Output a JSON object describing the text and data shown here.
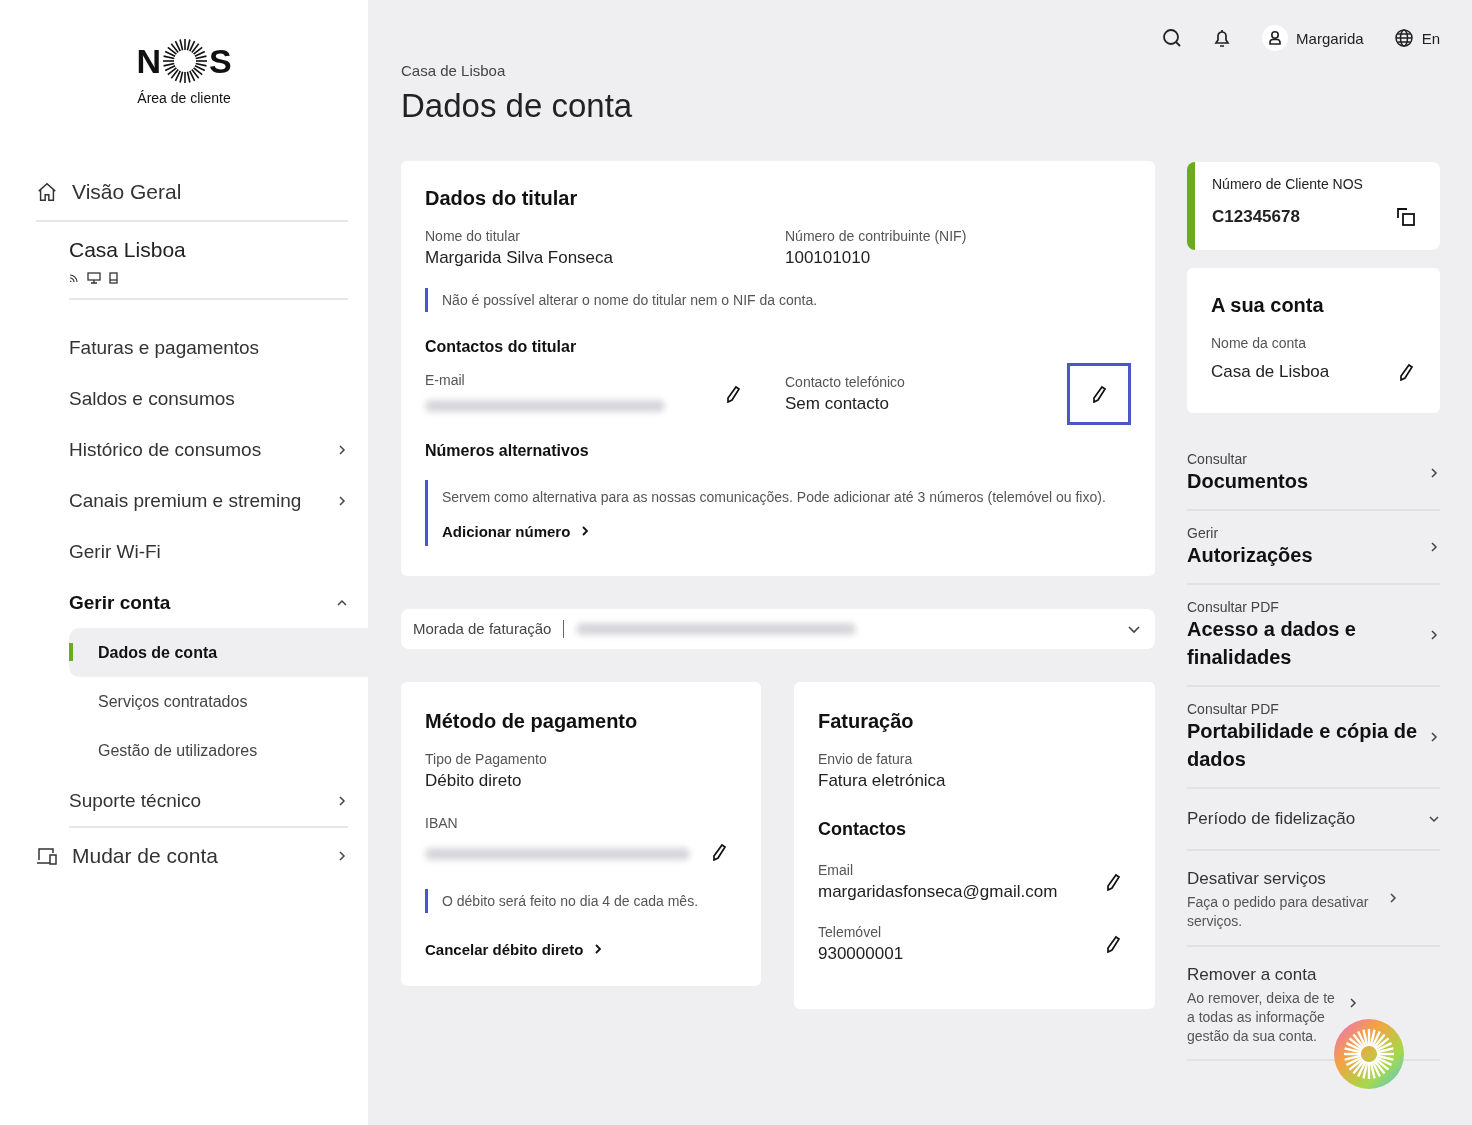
{
  "sidebar": {
    "logo": {
      "left": "N",
      "right": "S",
      "subtitle": "Área de cliente"
    },
    "overview": {
      "label": "Visão Geral"
    },
    "account": {
      "name": "Casa Lisboa"
    },
    "menu": [
      {
        "label": "Faturas e pagamentos",
        "has_submenu": false,
        "expanded": false
      },
      {
        "label": "Saldos e consumos",
        "has_submenu": false,
        "expanded": false
      },
      {
        "label": "Histórico de consumos",
        "has_submenu": true,
        "expanded": false
      },
      {
        "label": "Canais premium e streming",
        "has_submenu": true,
        "expanded": false
      },
      {
        "label": "Gerir Wi-Fi",
        "has_submenu": false,
        "expanded": false
      },
      {
        "label": "Gerir conta",
        "has_submenu": true,
        "expanded": true,
        "children": [
          {
            "label": "Dados de conta",
            "selected": true
          },
          {
            "label": "Serviços contratados",
            "selected": false
          },
          {
            "label": "Gestão de utilizadores",
            "selected": false
          }
        ]
      },
      {
        "label": "Suporte técnico",
        "has_submenu": true,
        "expanded": false
      }
    ],
    "switch_account": {
      "label": "Mudar de conta"
    }
  },
  "header": {
    "user": "Margarida",
    "language": "En"
  },
  "breadcrumb": "Casa de Lisboa",
  "title": "Dados de conta",
  "holder_card": {
    "title": "Dados do titular",
    "fields": [
      {
        "label": "Nome do titular",
        "value": "Margarida Silva Fonseca"
      },
      {
        "label": "Número de contribuinte (NIF)",
        "value": "100101010"
      }
    ],
    "note": "Não é possível alterar o nome do titular nem o NIF da conta.",
    "contacts_title": "Contactos do titular",
    "contacts": [
      {
        "label": "E-mail",
        "redacted": true,
        "highlighted": false
      },
      {
        "label": "Contacto telefónico",
        "value": "Sem contacto",
        "redacted": false,
        "highlighted": true
      }
    ],
    "alt_title": "Números alternativos",
    "alt_note": "Servem como alternativa para as nossas comunicações. Pode adicionar até 3 números (telemóvel ou fixo).",
    "alt_link": "Adicionar número"
  },
  "billing_address": {
    "label": "Morada de faturação",
    "expanded": false
  },
  "payment_card": {
    "title": "Método de pagamento",
    "type_label": "Tipo de Pagamento",
    "type_value": "Débito direto",
    "iban_label": "IBAN",
    "note": "O débito será feito no dia 4 de cada mês.",
    "link": "Cancelar débito direto"
  },
  "invoice_card": {
    "title": "Faturação",
    "send_label": "Envio de fatura",
    "send_value": "Fatura eletrónica",
    "contacts_title": "Contactos",
    "contacts": [
      {
        "label": "Email",
        "value": "margaridasfonseca@gmail.com"
      },
      {
        "label": "Telemóvel",
        "value": "930000001"
      }
    ]
  },
  "client_number": {
    "label": "Número de Cliente NOS",
    "value": "C12345678"
  },
  "your_account": {
    "title": "A sua conta",
    "label": "Nome da conta",
    "value": "Casa de Lisboa"
  },
  "links": [
    {
      "kind": "featured",
      "kicker": "Consultar",
      "title": "Documentos"
    },
    {
      "kind": "featured",
      "kicker": "Gerir",
      "title": "Autorizações"
    },
    {
      "kind": "featured",
      "kicker": "Consultar PDF",
      "title": "Acesso a dados e finalidades"
    },
    {
      "kind": "featured",
      "kicker": "Consultar PDF",
      "title": "Portabilidade e cópia de dados"
    },
    {
      "kind": "dropdown",
      "title": "Período de fidelização"
    },
    {
      "kind": "plain",
      "title": "Desativar serviços",
      "lines": [
        "Faça o pedido para desativar serviços."
      ]
    },
    {
      "kind": "plain",
      "title": "Remover a conta",
      "lines": [
        "Ao remover, deixa de te",
        "a todas as informaçõe",
        "gestão da sua conta."
      ]
    }
  ]
}
